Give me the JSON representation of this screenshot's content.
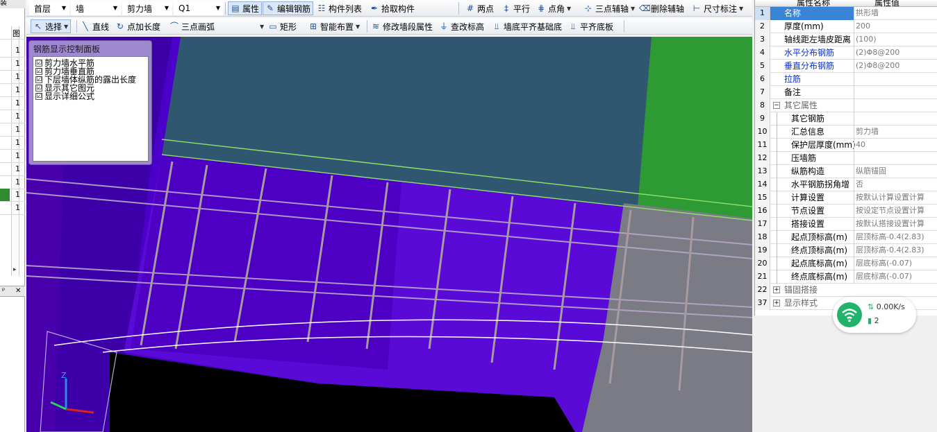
{
  "left_panel": {
    "top_label": "装",
    "header_mark": "图",
    "row_numbers": [
      "1",
      "1",
      "1",
      "1",
      "1",
      "1",
      "1",
      "1",
      "1",
      "1",
      "1",
      "1",
      "1"
    ],
    "scroll_arrow": "▸",
    "pin_label": "ᵖ",
    "close_label": "✕"
  },
  "toolbar1": {
    "floor": "首层",
    "type": "墙",
    "subtype": "剪力墙",
    "component": "Q1",
    "property_btn": "属性",
    "edit_rebar_btn": "编辑钢筋",
    "component_list_btn": "构件列表",
    "pick_component_btn": "拾取构件",
    "two_point_btn": "两点",
    "parallel_btn": "平行",
    "point_angle_btn": "点角",
    "three_point_aux_btn": "三点辅轴",
    "delete_aux_btn": "删除辅轴",
    "dimension_btn": "尺寸标注"
  },
  "toolbar2": {
    "select_btn": "选择",
    "line_btn": "直线",
    "point_length_btn": "点加长度",
    "arc_btn": "三点画弧",
    "rect_btn": "矩形",
    "smart_layout_btn": "智能布置",
    "modify_segment_btn": "修改墙段属性",
    "check_elevation_btn": "查改标高",
    "align_bottom_foundation_btn": "墙底平齐基础底",
    "align_bottom_btn": "平齐底板"
  },
  "rebar_panel": {
    "title": "钢筋显示控制面板",
    "items": [
      {
        "label": "剪力墙水平筋",
        "checked": "☑"
      },
      {
        "label": "剪力墙垂直筋",
        "checked": "☑"
      },
      {
        "label": "下层墙体纵筋的露出长度",
        "checked": "☑"
      },
      {
        "label": "显示其它图元",
        "checked": "☑"
      },
      {
        "label": "显示详细公式",
        "checked": "☑"
      }
    ]
  },
  "properties": {
    "header_name": "属性名称",
    "header_value": "属性值",
    "rows": [
      {
        "idx": "1",
        "name": "名称",
        "value": "拱形墙"
      },
      {
        "idx": "2",
        "name": "厚度(mm)",
        "value": "200"
      },
      {
        "idx": "3",
        "name": "轴线距左墙皮距离",
        "value": "(100)"
      },
      {
        "idx": "4",
        "name": "水平分布钢筋",
        "value": "(2)Φ8@200"
      },
      {
        "idx": "5",
        "name": "垂直分布钢筋",
        "value": "(2)Φ8@200"
      },
      {
        "idx": "6",
        "name": "拉筋",
        "value": ""
      },
      {
        "idx": "7",
        "name": "备注",
        "value": ""
      },
      {
        "idx": "8",
        "name": "其它属性",
        "value": ""
      },
      {
        "idx": "9",
        "name": "其它钢筋",
        "value": ""
      },
      {
        "idx": "10",
        "name": "汇总信息",
        "value": "剪力墙"
      },
      {
        "idx": "11",
        "name": "保护层厚度(mm)",
        "value": "40"
      },
      {
        "idx": "12",
        "name": "压墙筋",
        "value": ""
      },
      {
        "idx": "13",
        "name": "纵筋构造",
        "value": "纵筋锚固"
      },
      {
        "idx": "14",
        "name": "水平钢筋拐角增",
        "value": "否"
      },
      {
        "idx": "15",
        "name": "计算设置",
        "value": "按默认计算设置计算"
      },
      {
        "idx": "16",
        "name": "节点设置",
        "value": "按设定节点设置计算"
      },
      {
        "idx": "17",
        "name": "搭接设置",
        "value": "按默认搭接设置计算"
      },
      {
        "idx": "18",
        "name": "起点顶标高(m)",
        "value": "层顶标高-0.4(2.83)"
      },
      {
        "idx": "19",
        "name": "终点顶标高(m)",
        "value": "层顶标高-0.4(2.83)"
      },
      {
        "idx": "20",
        "name": "起点底标高(m)",
        "value": "层底标高(-0.07)"
      },
      {
        "idx": "21",
        "name": "终点底标高(m)",
        "value": "层底标高(-0.07)"
      },
      {
        "idx": "22",
        "name": "锚固搭接",
        "value": ""
      },
      {
        "idx": "37",
        "name": "显示样式",
        "value": ""
      }
    ],
    "expand_plus": "+",
    "expand_minus": "−"
  },
  "network": {
    "speed": "0.00K/s",
    "count": "2"
  },
  "axes": {
    "z": "Z"
  },
  "colors": {
    "viewport": "#4a00c8",
    "selected": "#3a84d6",
    "blue_text": "#0a2fd0"
  }
}
